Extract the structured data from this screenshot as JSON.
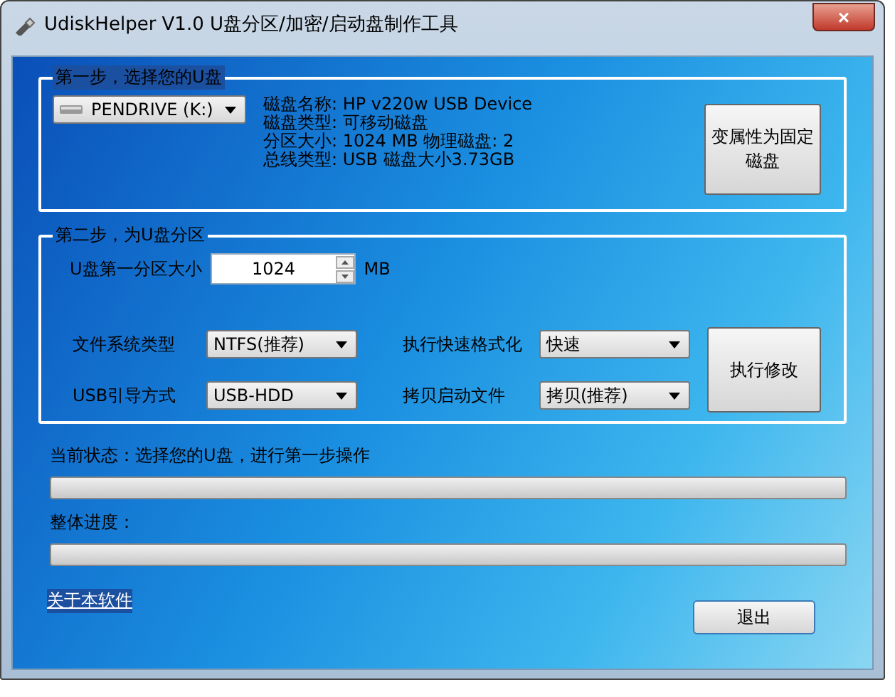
{
  "window": {
    "title": "UdiskHelper V1.0  U盘分区/加密/启动盘制作工具",
    "close": "×"
  },
  "step1": {
    "title": "第一步，选择您的U盘",
    "drive": "PENDRIVE (K:)",
    "info": [
      "磁盘名称: HP v220w USB Device",
      "磁盘类型: 可移动磁盘",
      "分区大小: 1024 MB   物理磁盘: 2",
      "总线类型: USB    磁盘大小3.73GB"
    ],
    "button": "变属性为固定磁盘"
  },
  "step2": {
    "title": "第二步，为U盘分区",
    "size_label": "U盘第一分区大小",
    "size_value": "1024",
    "size_unit": "MB",
    "options": [
      {
        "label": "文件系统类型",
        "value": "NTFS(推荐)"
      },
      {
        "label": "执行快速格式化",
        "value": "快速"
      },
      {
        "label": "USB引导方式",
        "value": "USB-HDD"
      },
      {
        "label": "拷贝启动文件",
        "value": "拷贝(推荐)"
      }
    ],
    "button": "执行修改"
  },
  "progress": [
    {
      "label": "当前状态：选择您的U盘，进行第一步操作",
      "level": 0
    },
    {
      "label": "整体进度：",
      "level": 0
    }
  ],
  "about_link": "关于本软件",
  "exit_button": "退出"
}
